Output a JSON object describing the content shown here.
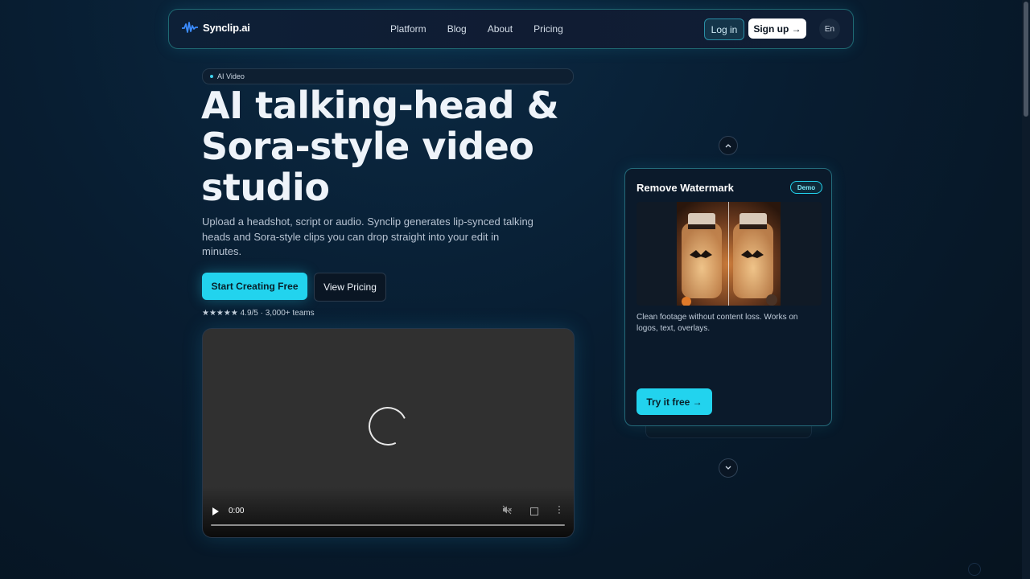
{
  "brand": {
    "name": "Synclip.ai",
    "icon": "waveform-icon"
  },
  "nav": {
    "links": [
      "Platform",
      "Blog",
      "About",
      "Pricing"
    ],
    "login_label": "Log in",
    "signup_label": "Sign up →",
    "lang_label": "En"
  },
  "hero": {
    "badge": "AI Video",
    "title_lines": [
      "AI talking-head &",
      "Sora-style video",
      "studio"
    ],
    "subtitle": "Upload a headshot, script or audio. Synclip generates lip-synced talking heads and Sora-style clips you can drop straight into your edit in minutes.",
    "primary_cta": "Start Creating Free",
    "secondary_cta": "View Pricing",
    "rating": "★★★★★ 4.9/5 · 3,000+ teams"
  },
  "video": {
    "time": "0:00",
    "progress": 0
  },
  "carousel": {
    "card_title": "Remove Watermark",
    "card_badge": "Demo",
    "card_description": "Clean footage without content loss. Works on logos, text, overlays.",
    "card_cta": "Try it free →",
    "up_icon": "chevron-up-icon",
    "down_icon": "chevron-down-icon"
  },
  "colors": {
    "accent": "#22d3ee",
    "background": "#071726",
    "card_border": "#246a7a"
  }
}
